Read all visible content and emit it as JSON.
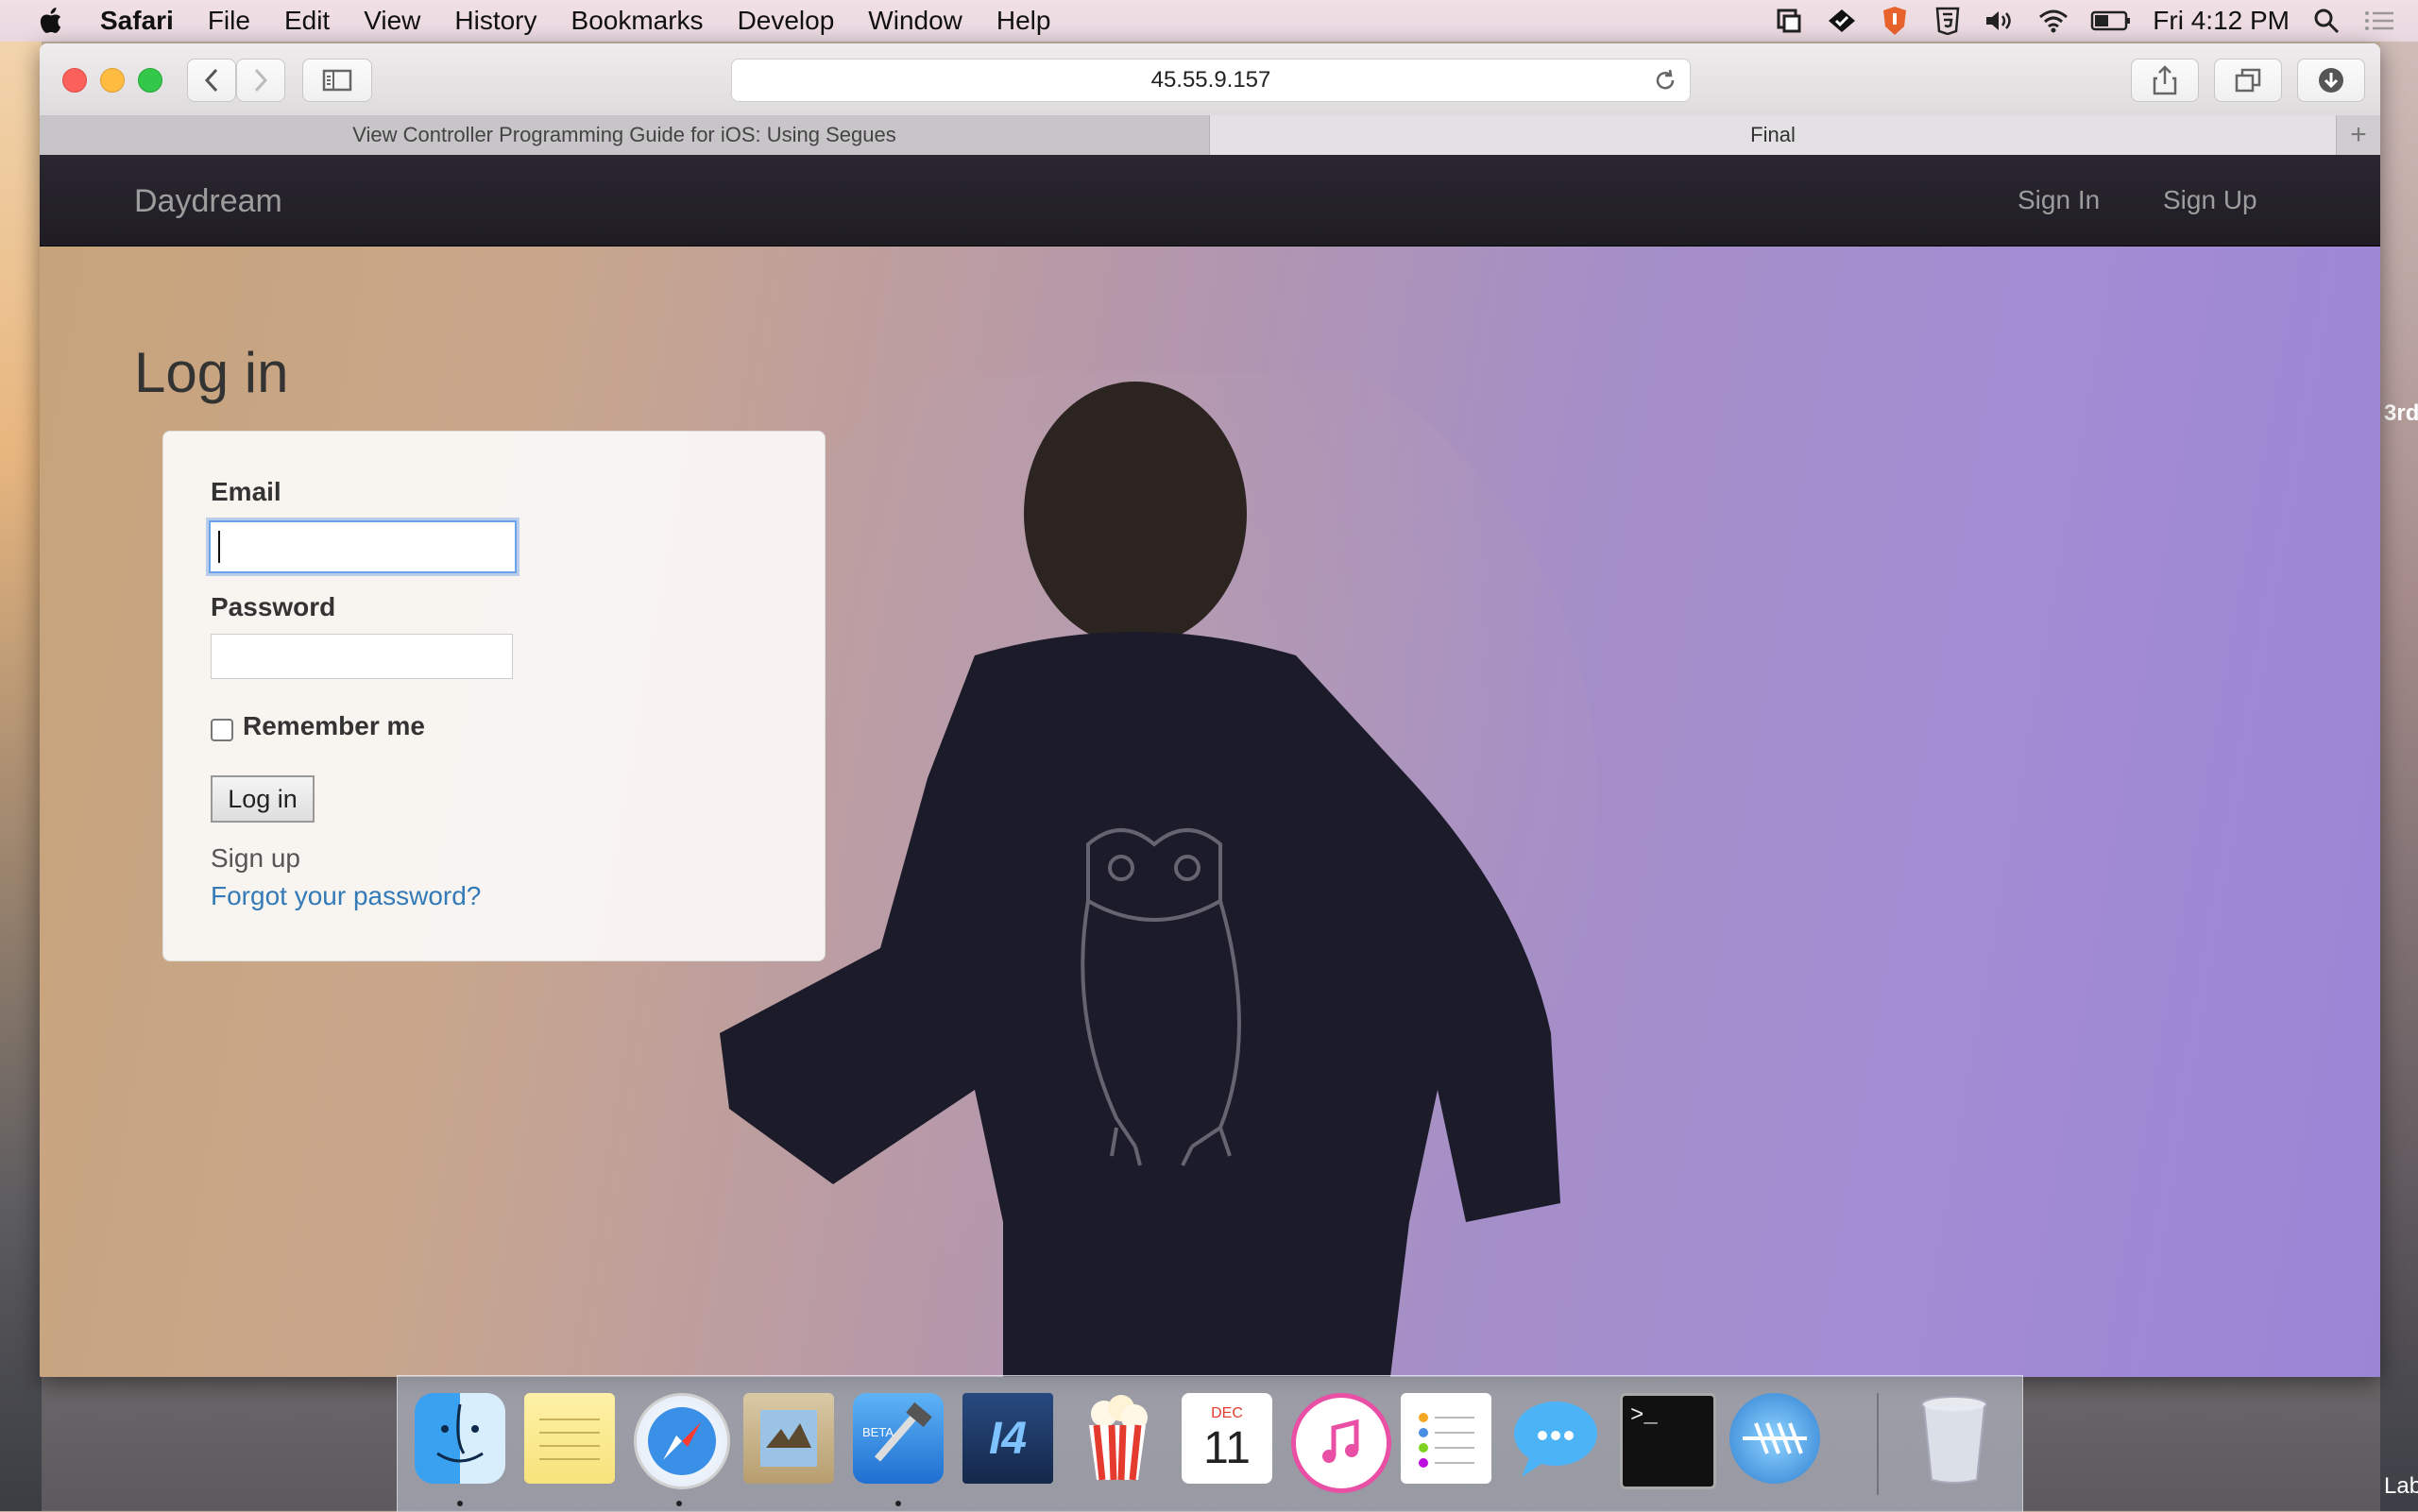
{
  "menubar": {
    "app": "Safari",
    "menus": [
      "File",
      "Edit",
      "View",
      "History",
      "Bookmarks",
      "Develop",
      "Window",
      "Help"
    ],
    "clock": "Fri 4:12 PM",
    "status_icons": [
      "screen-capture-icon",
      "feedly-icon",
      "brave-shield-icon",
      "html5-icon",
      "volume-icon",
      "wifi-icon",
      "battery-icon",
      "spotlight-icon",
      "notification-center-icon"
    ]
  },
  "browser": {
    "url": "45.55.9.157",
    "tabs": [
      {
        "label": "View Controller Programming Guide for iOS: Using Segues",
        "active": false
      },
      {
        "label": "Final",
        "active": true
      }
    ]
  },
  "navbar": {
    "brand": "Daydream",
    "links": [
      "Sign In",
      "Sign Up"
    ]
  },
  "login": {
    "title": "Log in",
    "email_label": "Email",
    "email_value": "",
    "password_label": "Password",
    "password_value": "",
    "remember_label": "Remember me",
    "remember_checked": false,
    "submit_label": "Log in",
    "signup_link": "Sign up",
    "forgot_link": "Forgot your password?"
  },
  "desktop": {
    "edge_text_top": "3rd",
    "edge_text_bottom": "Lab"
  },
  "dock": {
    "apps": [
      "Finder",
      "Notes",
      "Safari",
      "Preview",
      "Xcode Beta",
      "Instruments",
      "Popcorn Time",
      "Calendar",
      "iTunes",
      "Reminders",
      "Messages",
      "Terminal",
      "Network Tool",
      "Trash"
    ],
    "calendar_month": "DEC",
    "calendar_day": "11",
    "instruments_label": "I4",
    "beta_label": "BETA",
    "terminal_prompt": ">_"
  },
  "colors": {
    "link_blue": "#337ab7",
    "focus_ring": "#6aa3ea",
    "navbar_bg": "#222222"
  }
}
